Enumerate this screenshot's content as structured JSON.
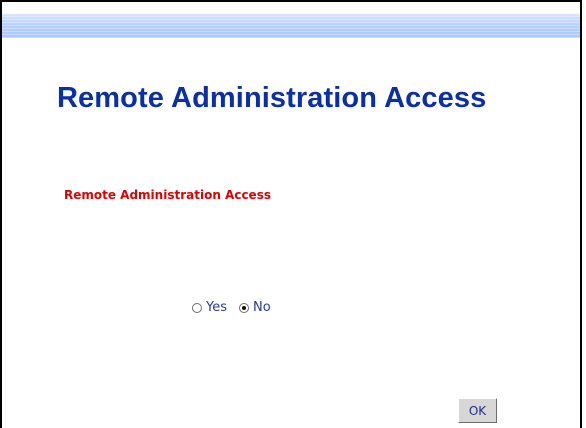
{
  "page": {
    "title": "Remote Administration Access",
    "section_label": "Remote Administration Access"
  },
  "remote_admin": {
    "options": [
      {
        "label": "Yes",
        "selected": false
      },
      {
        "label": "No",
        "selected": true
      }
    ],
    "selected_value": "No"
  },
  "actions": {
    "ok_label": "OK"
  },
  "colors": {
    "title": "#0b2fa6",
    "section_label": "#e00000",
    "radio_text": "#2a3c8f",
    "top_band": "#b7d1ff",
    "button_face": "#d7d7d7"
  }
}
